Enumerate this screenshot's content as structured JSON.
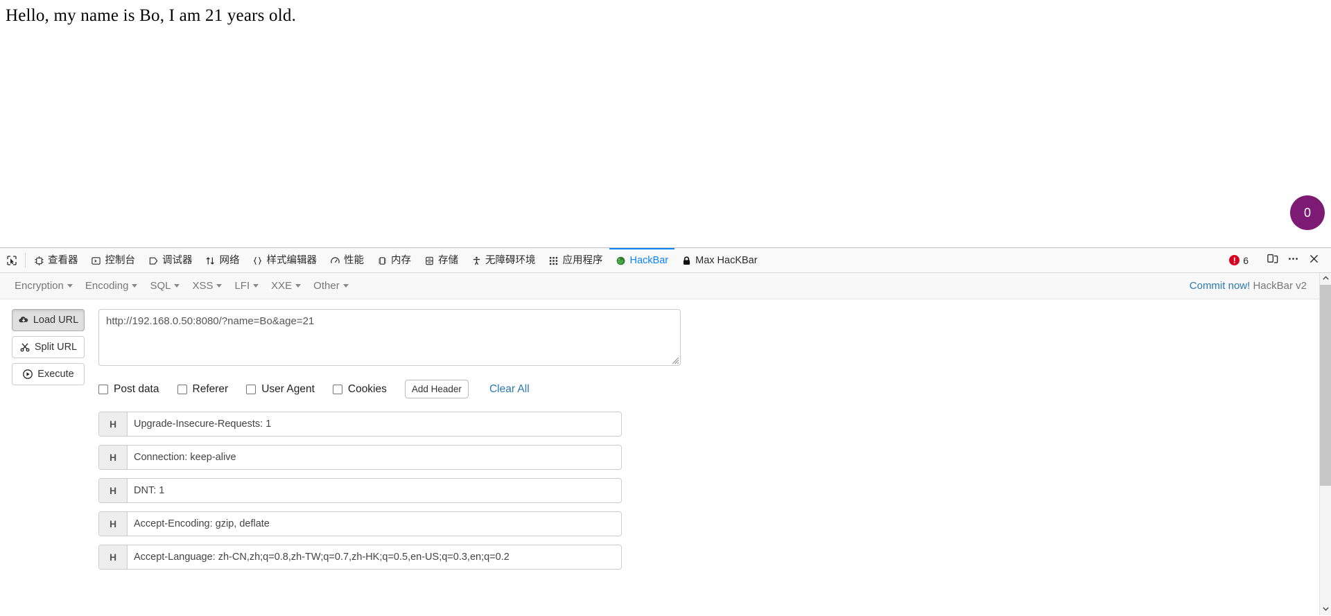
{
  "page": {
    "body_text": "Hello, my name is Bo, I am 21 years old.",
    "floating_counter": "0",
    "floating_counter_color": "#7d1b74"
  },
  "devtools": {
    "picker_icon": "element-picker-icon",
    "tabs": [
      {
        "label": "查看器",
        "icon": "inspector-icon",
        "active": false
      },
      {
        "label": "控制台",
        "icon": "console-icon",
        "active": false
      },
      {
        "label": "调试器",
        "icon": "debugger-icon",
        "active": false
      },
      {
        "label": "网络",
        "icon": "network-icon",
        "active": false
      },
      {
        "label": "样式编辑器",
        "icon": "style-editor-icon",
        "active": false
      },
      {
        "label": "性能",
        "icon": "performance-icon",
        "active": false
      },
      {
        "label": "内存",
        "icon": "memory-icon",
        "active": false
      },
      {
        "label": "存储",
        "icon": "storage-icon",
        "active": false
      },
      {
        "label": "无障碍环境",
        "icon": "accessibility-icon",
        "active": false
      },
      {
        "label": "应用程序",
        "icon": "application-icon",
        "active": false
      },
      {
        "label": "HackBar",
        "icon": "hackbar-globe-icon",
        "active": true
      },
      {
        "label": "Max HacKBar",
        "icon": "lock-icon",
        "active": false
      }
    ],
    "active_tab_color": "#0a84ff",
    "error_count": "6",
    "error_color": "#d70022",
    "dock_icon": "dock-layout-icon",
    "more_icon": "more-options-icon",
    "close_icon": "close-icon"
  },
  "hackbar": {
    "menu": [
      {
        "label": "Encryption"
      },
      {
        "label": "Encoding"
      },
      {
        "label": "SQL"
      },
      {
        "label": "XSS"
      },
      {
        "label": "LFI"
      },
      {
        "label": "XXE"
      },
      {
        "label": "Other"
      }
    ],
    "commit_link": "Commit now!",
    "version": "HackBar v2",
    "link_color": "#2a7ab0",
    "actions": [
      {
        "label": "Load URL",
        "icon": "cloud-download-icon",
        "pressed": true
      },
      {
        "label": "Split URL",
        "icon": "scissors-icon",
        "pressed": false
      },
      {
        "label": "Execute",
        "icon": "play-circle-icon",
        "pressed": false
      }
    ],
    "url_value": "http://192.168.0.50:8080/?name=Bo&age=21",
    "url_placeholder": "",
    "checkboxes": [
      {
        "label": "Post data",
        "checked": false
      },
      {
        "label": "Referer",
        "checked": false
      },
      {
        "label": "User Agent",
        "checked": false
      },
      {
        "label": "Cookies",
        "checked": false
      }
    ],
    "add_header_label": "Add Header",
    "clear_all_label": "Clear All",
    "header_tag": "H",
    "headers": [
      {
        "value": "Upgrade-Insecure-Requests: 1"
      },
      {
        "value": "Connection: keep-alive"
      },
      {
        "value": "DNT: 1"
      },
      {
        "value": "Accept-Encoding: gzip, deflate"
      },
      {
        "value": "Accept-Language: zh-CN,zh;q=0.8,zh-TW;q=0.7,zh-HK;q=0.5,en-US;q=0.3,en;q=0.2"
      }
    ]
  }
}
